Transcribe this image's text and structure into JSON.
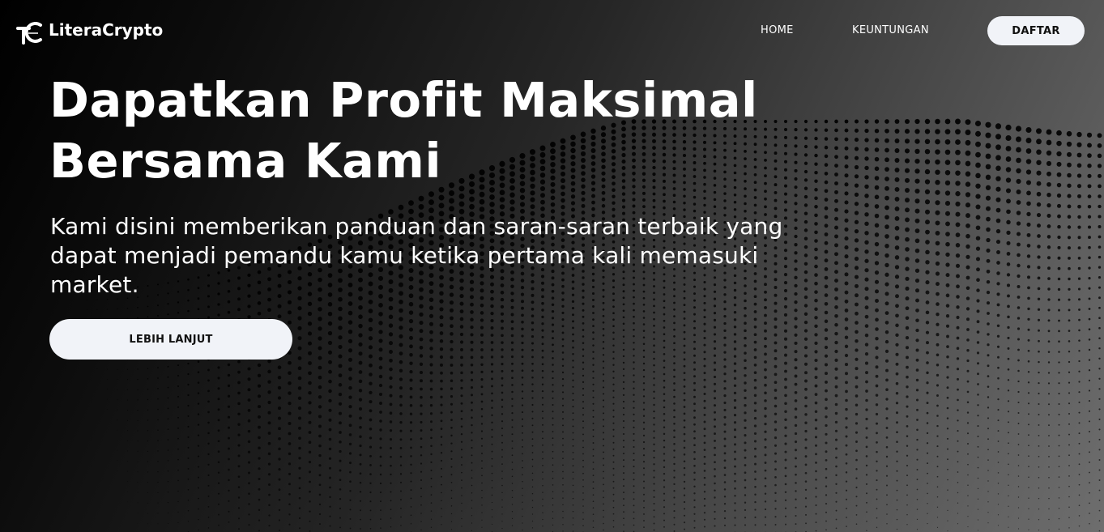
{
  "header": {
    "logo_text": "LiteraCrypto",
    "logo_icon": "litera-crypto-logo-icon",
    "nav": [
      {
        "label": "HOME"
      },
      {
        "label": "KEUNTUNGAN"
      }
    ],
    "cta_label": "DAFTAR"
  },
  "hero": {
    "title_line1": "Dapatkan Profit Maksimal",
    "title_line2": "Bersama Kami",
    "subtitle": "Kami disini memberikan panduan dan saran-saran terbaik yang dapat menjadi pemandu kamu ketika pertama kali memasuki market.",
    "button_label": "LEBIH LANJUT"
  },
  "colors": {
    "button_bg": "#f1f3f8",
    "button_text": "#111111",
    "text": "#ffffff",
    "bg_dark": "#000000",
    "bg_light": "#6e6e6e"
  }
}
